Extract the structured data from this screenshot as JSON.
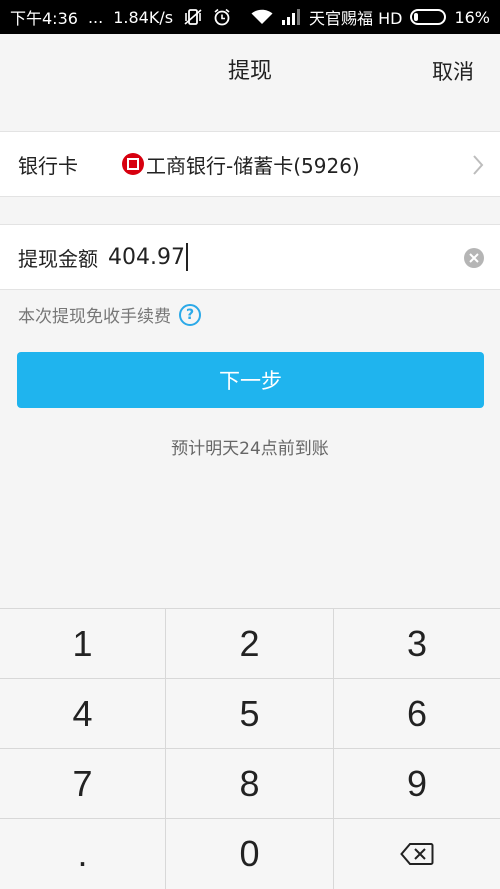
{
  "status_bar": {
    "time": "下午4:36",
    "dots": "...",
    "speed": "1.84K/s",
    "carrier": "天官赐福 HD",
    "battery": "16%",
    "battery_level": 0.16
  },
  "header": {
    "title": "提现",
    "cancel_label": "取消"
  },
  "bank_card": {
    "label": "银行卡",
    "bank_name": "工商银行-储蓄卡(5926)"
  },
  "amount": {
    "label": "提现金额",
    "value": "404.97"
  },
  "fee_note": "本次提现免收手续费",
  "help_glyph": "?",
  "next_button": "下一步",
  "arrival_note": "预计明天24点前到账",
  "keypad": {
    "keys": [
      "1",
      "2",
      "3",
      "4",
      "5",
      "6",
      "7",
      "8",
      "9",
      ".",
      "0"
    ]
  },
  "colors": {
    "accent": "#1fb4ee",
    "bank_red": "#d7000f",
    "help_blue": "#2ba9e8"
  }
}
